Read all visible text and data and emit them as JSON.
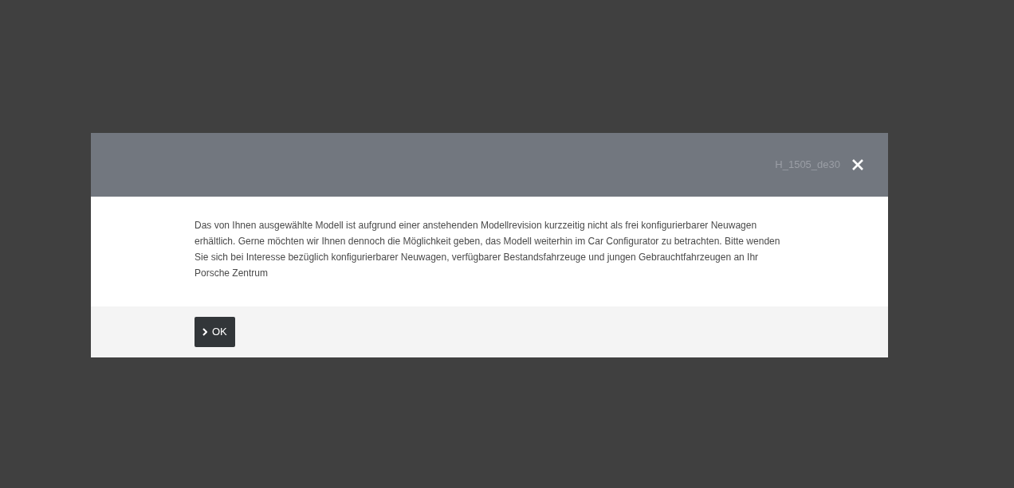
{
  "dialog": {
    "code": "H_1505_de30",
    "message": "Das von Ihnen ausgewählte Modell ist aufgrund einer anstehenden Modellrevision kurzzeitig nicht als frei konfigurierbarer Neuwagen erhältlich. Gerne möchten wir Ihnen dennoch die Möglichkeit geben, das Modell weiterhin im Car Configurator zu betrachten. Bitte wenden Sie sich bei Interesse bezüglich konfigurierbarer Neuwagen, verfügbarer Bestandsfahrzeuge und jungen Gebrauchtfahrzeugen an Ihr Porsche Zentrum",
    "ok_button": "OK"
  }
}
